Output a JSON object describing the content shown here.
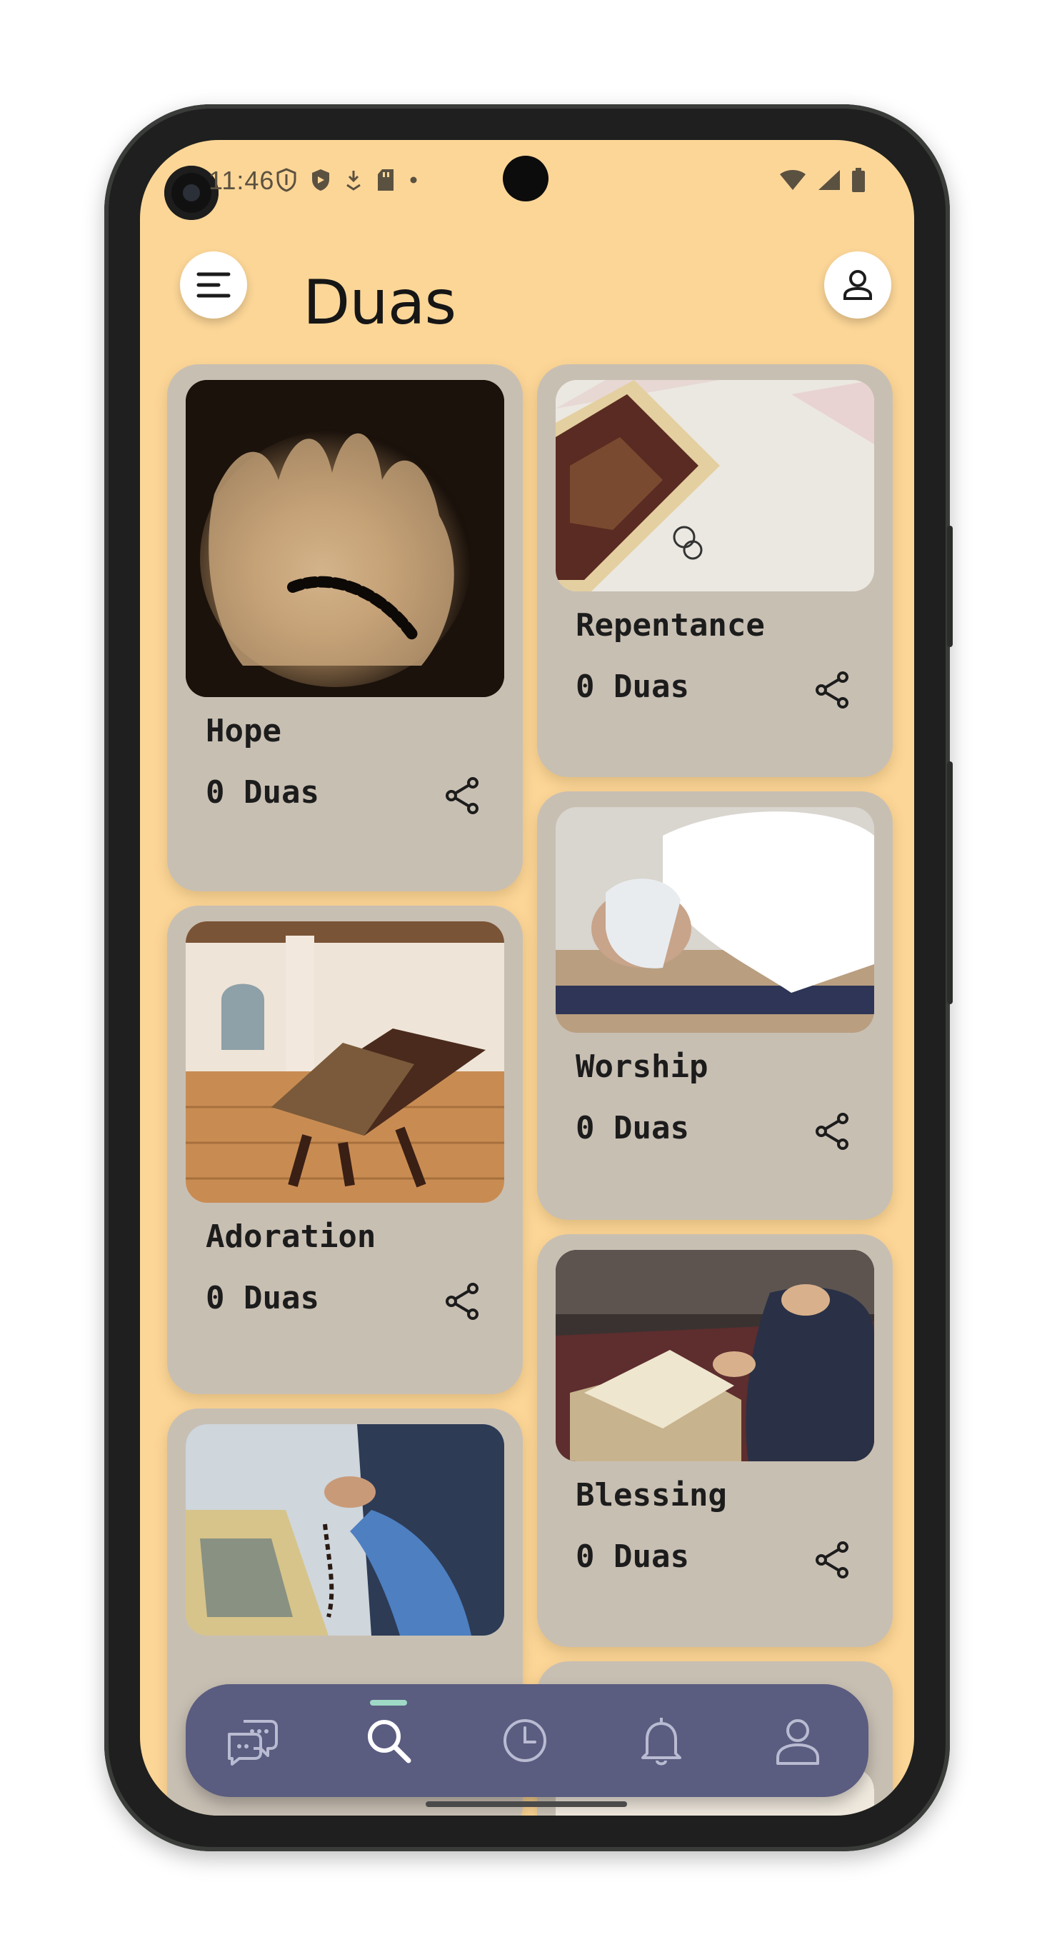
{
  "status_bar": {
    "time": "11:46"
  },
  "header": {
    "title": "Duas"
  },
  "cards": [
    {
      "title": "Hope",
      "count": "0 Duas"
    },
    {
      "title": "Repentance",
      "count": "0 Duas"
    },
    {
      "title": "Worship",
      "count": "0 Duas"
    },
    {
      "title": "Adoration",
      "count": "0 Duas"
    },
    {
      "title": "Blessing",
      "count": "0 Duas"
    }
  ],
  "icons": {
    "menu": "menu-icon",
    "profile": "profile-icon",
    "share": "share-icon",
    "nav": [
      "chat-icon",
      "search-icon",
      "history-icon",
      "bell-icon",
      "user-icon"
    ]
  },
  "colors": {
    "background": "#fcd697",
    "card": "#c8bfb3",
    "nav_bar": "#5a5c80",
    "nav_active_indicator": "#9fd9c6"
  }
}
